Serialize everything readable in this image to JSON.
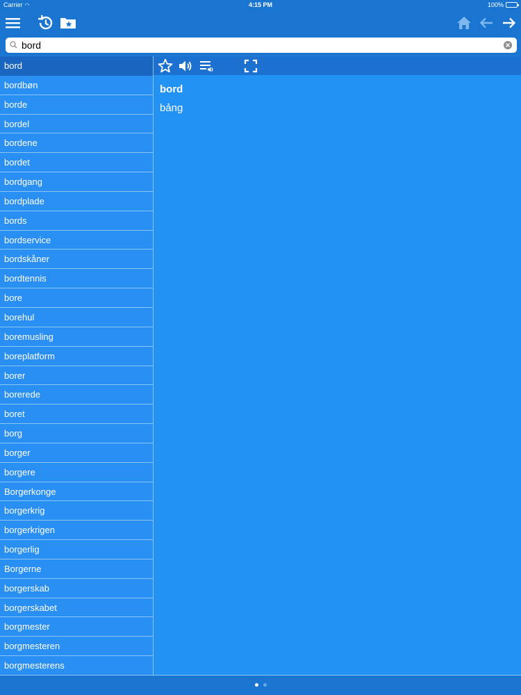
{
  "status_bar": {
    "carrier": "Carrier",
    "time": "4:15 PM",
    "battery": "100%",
    "battery_level": 1.0
  },
  "toolbar": {
    "left_icons": [
      "menu-icon",
      "history-icon",
      "favorites-folder-icon"
    ],
    "right_icons": [
      "home-icon",
      "back-arrow-icon",
      "forward-arrow-icon"
    ]
  },
  "search": {
    "value": "bord",
    "placeholder": ""
  },
  "word_list": {
    "selected_index": 0,
    "items": [
      "bord",
      "bordbøn",
      "borde",
      "bordel",
      "bordene",
      "bordet",
      "bordgang",
      "bordplade",
      "bords",
      "bordservice",
      "bordskåner",
      "bordtennis",
      "bore",
      "borehul",
      "boremusling",
      "boreplatform",
      "borer",
      "borerede",
      "boret",
      "borg",
      "borger",
      "borgere",
      "Borgerkonge",
      "borgerkrig",
      "borgerkrigen",
      "borgerlig",
      "Borgerne",
      "borgerskab",
      "borgerskabet",
      "borgmester",
      "borgmesteren",
      "borgmesterens"
    ]
  },
  "detail": {
    "headword": "bord",
    "translation": "bảng",
    "toolbar_icons": [
      "star-icon",
      "speaker-icon",
      "playlist-audio-icon",
      "fullscreen-icon"
    ]
  },
  "pager": {
    "pages": 2,
    "current": 0
  },
  "colors": {
    "bar": "#1a75d1",
    "list_bg": "#2a8ff2",
    "selected_row": "#1a65c0",
    "detail_bg": "#2392f5",
    "separator": "#8cc4f6"
  }
}
